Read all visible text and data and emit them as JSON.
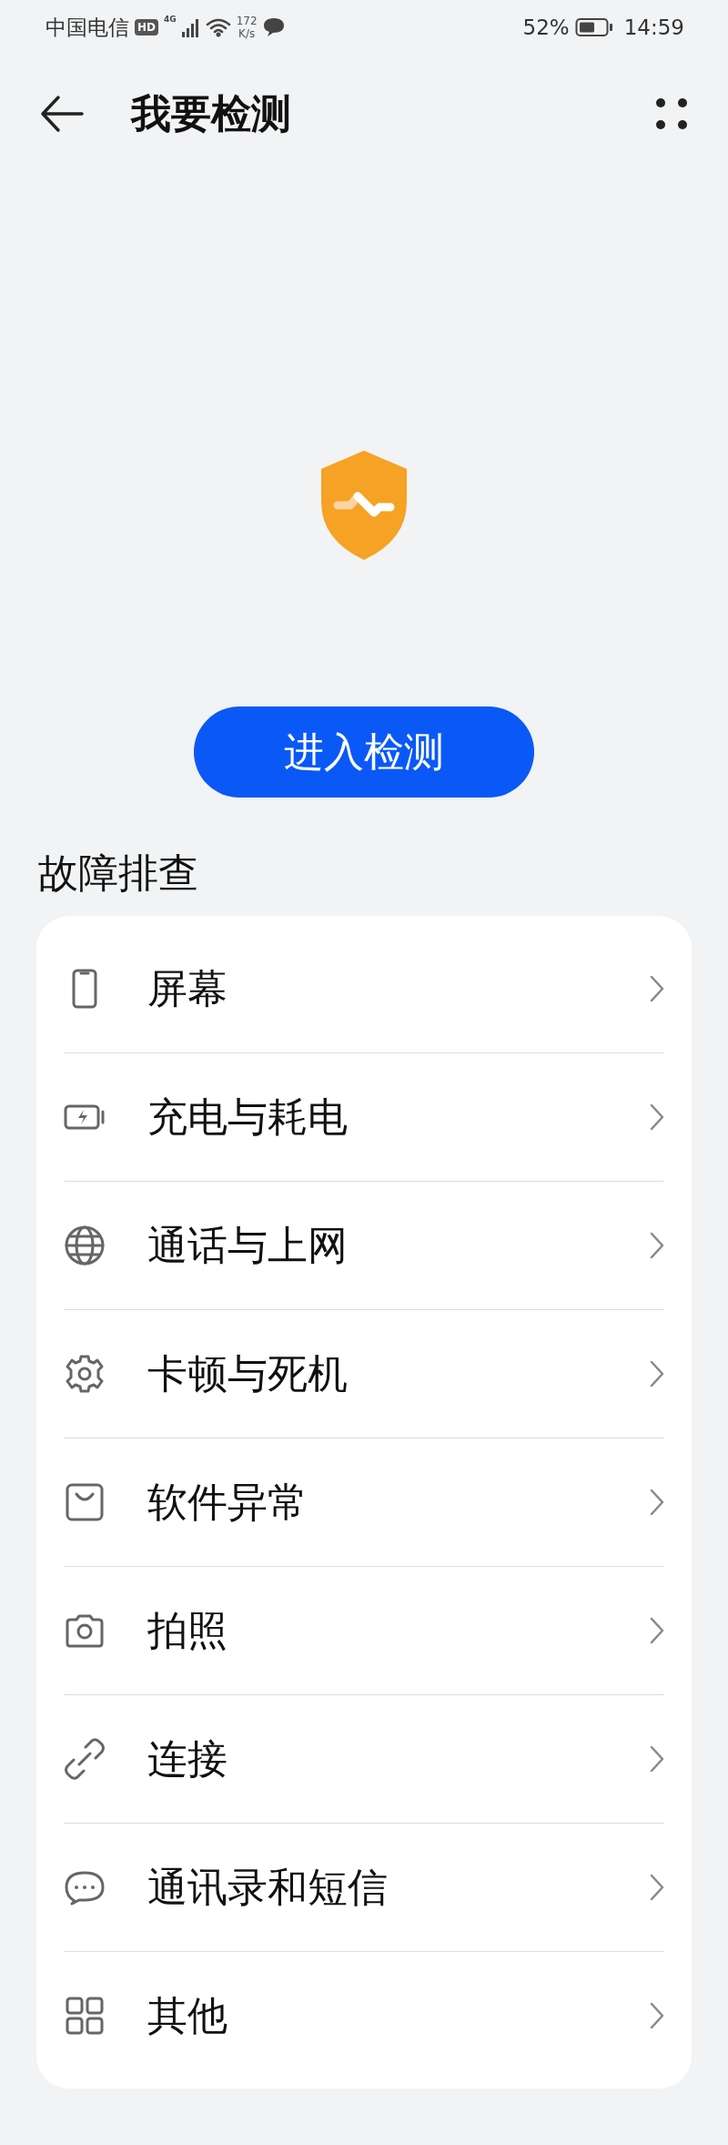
{
  "status_bar": {
    "carrier": "中国电信",
    "hd_badge": "HD",
    "network": "4G",
    "speed_value": "172",
    "speed_unit": "K/s",
    "battery_percent": "52%",
    "time": "14:59"
  },
  "header": {
    "title": "我要检测"
  },
  "detect_button": "进入检测",
  "section_title": "故障排查",
  "items": [
    {
      "kind": "screen",
      "label": "屏幕"
    },
    {
      "kind": "battery",
      "label": "充电与耗电"
    },
    {
      "kind": "globe",
      "label": "通话与上网"
    },
    {
      "kind": "gear",
      "label": "卡顿与死机"
    },
    {
      "kind": "bag",
      "label": "软件异常"
    },
    {
      "kind": "camera",
      "label": "拍照"
    },
    {
      "kind": "link",
      "label": "连接"
    },
    {
      "kind": "chat",
      "label": "通讯录和短信"
    },
    {
      "kind": "grid",
      "label": "其他"
    }
  ]
}
